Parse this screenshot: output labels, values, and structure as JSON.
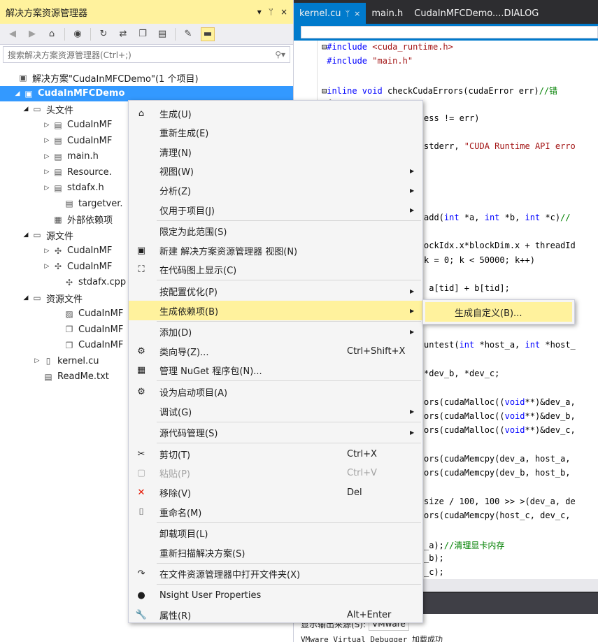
{
  "solution_explorer": {
    "title": "解决方案资源管理器",
    "title_controls": [
      "▾",
      "ᛘ",
      "×"
    ],
    "search_placeholder": "搜索解决方案资源管理器(Ctrl+;)",
    "tree": [
      {
        "label": "解决方案\"CudaInMFCDemo\"(1 个项目)",
        "expander": "",
        "icon": "▣",
        "icon_name": "solution-icon"
      },
      {
        "label": "CudaInMFCDemo",
        "expander": "◢",
        "icon": "▣",
        "icon_name": "project-icon",
        "selected": true
      },
      {
        "label": "头文件",
        "expander": "◢",
        "icon": "▭",
        "icon_name": "folder-icon"
      },
      {
        "label": "CudaInMF",
        "expander": "▷",
        "icon": "▤",
        "icon_name": "header-file-icon"
      },
      {
        "label": "CudaInMF",
        "expander": "▷",
        "icon": "▤",
        "icon_name": "header-file-icon"
      },
      {
        "label": "main.h",
        "expander": "▷",
        "icon": "▤",
        "icon_name": "header-file-icon"
      },
      {
        "label": "Resource.",
        "expander": "▷",
        "icon": "▤",
        "icon_name": "header-file-icon"
      },
      {
        "label": "stdafx.h",
        "expander": "▷",
        "icon": "▤",
        "icon_name": "header-file-icon"
      },
      {
        "label": "targetver.",
        "expander": "",
        "icon": "▤",
        "icon_name": "header-file-icon"
      },
      {
        "label": "外部依赖项",
        "expander": "",
        "icon": "▦",
        "icon_name": "external-deps-icon"
      },
      {
        "label": "源文件",
        "expander": "◢",
        "icon": "▭",
        "icon_name": "folder-icon"
      },
      {
        "label": "CudaInMF",
        "expander": "▷",
        "icon": "✣",
        "icon_name": "cpp-file-icon"
      },
      {
        "label": "CudaInMF",
        "expander": "▷",
        "icon": "✣",
        "icon_name": "cpp-file-icon"
      },
      {
        "label": "stdafx.cpp",
        "expander": "",
        "icon": "✣",
        "icon_name": "cpp-file-icon"
      },
      {
        "label": "资源文件",
        "expander": "◢",
        "icon": "▭",
        "icon_name": "folder-icon"
      },
      {
        "label": "CudaInMF",
        "expander": "",
        "icon": "▨",
        "icon_name": "image-file-icon"
      },
      {
        "label": "CudaInMF",
        "expander": "",
        "icon": "❐",
        "icon_name": "resource-file-icon"
      },
      {
        "label": "CudaInMF",
        "expander": "",
        "icon": "❐",
        "icon_name": "resource-file-icon"
      },
      {
        "label": "kernel.cu",
        "expander": "▷",
        "icon": "▯",
        "icon_name": "cu-file-icon"
      },
      {
        "label": "ReadMe.txt",
        "expander": "",
        "icon": "▤",
        "icon_name": "text-file-icon"
      }
    ]
  },
  "editor": {
    "tabs": [
      {
        "label": "kernel.cu",
        "pin": "ᛘ",
        "close": "×",
        "active": true
      },
      {
        "label": "main.h",
        "active": false
      },
      {
        "label": "CudaInMFCDemo....DIALOG",
        "active": false
      }
    ],
    "code_lines": [
      {
        "parts": [
          {
            "t": "⊟",
            "c": ""
          },
          {
            "t": "#include ",
            "c": "kw"
          },
          {
            "t": "<cuda_runtime.h>",
            "c": "str"
          }
        ]
      },
      {
        "parts": [
          {
            "t": " #include ",
            "c": "kw"
          },
          {
            "t": "\"main.h\"",
            "c": "str"
          }
        ]
      },
      {
        "parts": [
          {
            "t": "",
            "c": ""
          }
        ]
      },
      {
        "parts": [
          {
            "t": "⊟",
            "c": ""
          },
          {
            "t": "inline void ",
            "c": "kw"
          },
          {
            "t": "checkCudaErrors(cudaError err)",
            "c": ""
          },
          {
            "t": "//错",
            "c": "cm"
          }
        ]
      },
      {
        "parts": [
          {
            "t": " {",
            "c": ""
          }
        ]
      },
      {
        "parts": [
          {
            "t": "ess != err)",
            "c": ""
          }
        ]
      },
      {
        "parts": [
          {
            "t": "",
            "c": ""
          }
        ]
      },
      {
        "parts": [
          {
            "t": "stderr, ",
            "c": ""
          },
          {
            "t": "\"CUDA Runtime API erro",
            "c": "str"
          }
        ]
      },
      {
        "parts": [
          {
            "t": "",
            "c": ""
          }
        ]
      },
      {
        "parts": [
          {
            "t": "",
            "c": ""
          }
        ]
      },
      {
        "parts": [
          {
            "t": "",
            "c": ""
          }
        ]
      },
      {
        "parts": [
          {
            "t": "",
            "c": ""
          }
        ]
      },
      {
        "parts": [
          {
            "t": "add(",
            "c": ""
          },
          {
            "t": "int ",
            "c": "kw"
          },
          {
            "t": "*a, ",
            "c": ""
          },
          {
            "t": "int ",
            "c": "kw"
          },
          {
            "t": "*b, ",
            "c": ""
          },
          {
            "t": "int ",
            "c": "kw"
          },
          {
            "t": "*c)",
            "c": ""
          },
          {
            "t": "//",
            "c": "cm"
          }
        ]
      },
      {
        "parts": [
          {
            "t": "",
            "c": ""
          }
        ]
      },
      {
        "parts": [
          {
            "t": "ockIdx.x*blockDim.x + threadId",
            "c": ""
          }
        ]
      },
      {
        "parts": [
          {
            "t": "k = 0; k < 50000; k++)",
            "c": ""
          }
        ]
      },
      {
        "parts": [
          {
            "t": "",
            "c": ""
          }
        ]
      },
      {
        "parts": [
          {
            "t": " a[tid] + b[tid];",
            "c": ""
          }
        ]
      },
      {
        "parts": [
          {
            "t": "",
            "c": ""
          }
        ]
      },
      {
        "parts": [
          {
            "t": "",
            "c": ""
          }
        ]
      },
      {
        "parts": [
          {
            "t": "",
            "c": ""
          }
        ]
      },
      {
        "parts": [
          {
            "t": "untest(",
            "c": ""
          },
          {
            "t": "int ",
            "c": "kw"
          },
          {
            "t": "*host_a, ",
            "c": ""
          },
          {
            "t": "int ",
            "c": "kw"
          },
          {
            "t": "*host_",
            "c": ""
          }
        ]
      },
      {
        "parts": [
          {
            "t": "",
            "c": ""
          }
        ]
      },
      {
        "parts": [
          {
            "t": "*dev_b, *dev_c;",
            "c": ""
          }
        ]
      },
      {
        "parts": [
          {
            "t": "",
            "c": ""
          }
        ]
      },
      {
        "parts": [
          {
            "t": "ors(cudaMalloc((",
            "c": ""
          },
          {
            "t": "void",
            "c": "kw"
          },
          {
            "t": "**)&dev_a,",
            "c": ""
          }
        ]
      },
      {
        "parts": [
          {
            "t": "ors(cudaMalloc((",
            "c": ""
          },
          {
            "t": "void",
            "c": "kw"
          },
          {
            "t": "**)&dev_b,",
            "c": ""
          }
        ]
      },
      {
        "parts": [
          {
            "t": "ors(cudaMalloc((",
            "c": ""
          },
          {
            "t": "void",
            "c": "kw"
          },
          {
            "t": "**)&dev_c,",
            "c": ""
          }
        ]
      },
      {
        "parts": [
          {
            "t": "",
            "c": ""
          }
        ]
      },
      {
        "parts": [
          {
            "t": "ors(cudaMemcpy(dev_a, host_a,",
            "c": ""
          }
        ]
      },
      {
        "parts": [
          {
            "t": "ors(cudaMemcpy(dev_b, host_b,",
            "c": ""
          }
        ]
      },
      {
        "parts": [
          {
            "t": "",
            "c": ""
          }
        ]
      },
      {
        "parts": [
          {
            "t": "size / 100, 100 >> >(dev_a, de",
            "c": ""
          }
        ]
      },
      {
        "parts": [
          {
            "t": "ors(cudaMemcpy(host_c, dev_c,",
            "c": ""
          }
        ]
      },
      {
        "parts": [
          {
            "t": "",
            "c": ""
          }
        ]
      },
      {
        "parts": [
          {
            "t": "_a);",
            "c": ""
          },
          {
            "t": "//清理显卡内存",
            "c": "cm"
          }
        ]
      },
      {
        "parts": [
          {
            "t": "_b);",
            "c": ""
          }
        ]
      },
      {
        "parts": [
          {
            "t": "_c);",
            "c": ""
          }
        ]
      }
    ]
  },
  "output": {
    "source_label": "显示输出来源(S):",
    "source_value": "VMware",
    "line": "VMware Virtual Debugger 加载成功"
  },
  "context_menu": {
    "items": [
      {
        "label": "生成(U)",
        "icon": "⌂",
        "icon_name": "build-icon"
      },
      {
        "label": "重新生成(E)"
      },
      {
        "label": "清理(N)"
      },
      {
        "label": "视图(W)",
        "submenu": true
      },
      {
        "label": "分析(Z)",
        "submenu": true
      },
      {
        "label": "仅用于项目(J)",
        "submenu": true
      },
      {
        "sep": true
      },
      {
        "label": "限定为此范围(S)"
      },
      {
        "label": "新建 解决方案资源管理器 视图(N)",
        "icon": "▣",
        "icon_name": "new-view-icon"
      },
      {
        "label": "在代码图上显示(C)",
        "icon": "⛶",
        "icon_name": "code-map-icon"
      },
      {
        "sep": true
      },
      {
        "label": "按配置优化(P)",
        "submenu": true
      },
      {
        "label": "生成依赖项(B)",
        "submenu": true,
        "highlight": true
      },
      {
        "sep": true
      },
      {
        "label": "添加(D)",
        "submenu": true
      },
      {
        "label": "类向导(Z)...",
        "shortcut": "Ctrl+Shift+X",
        "icon": "⚙",
        "icon_name": "class-wizard-icon"
      },
      {
        "label": "管理 NuGet 程序包(N)...",
        "icon": "▦",
        "icon_name": "nuget-icon"
      },
      {
        "sep": true
      },
      {
        "label": "设为启动项目(A)",
        "icon": "⚙",
        "icon_name": "startup-gear-icon"
      },
      {
        "label": "调试(G)",
        "submenu": true
      },
      {
        "sep": true
      },
      {
        "label": "源代码管理(S)",
        "submenu": true
      },
      {
        "sep": true
      },
      {
        "label": "剪切(T)",
        "shortcut": "Ctrl+X",
        "icon": "✂",
        "icon_name": "cut-icon"
      },
      {
        "label": "粘贴(P)",
        "shortcut": "Ctrl+V",
        "icon": "▢",
        "icon_name": "paste-icon",
        "disabled": true
      },
      {
        "label": "移除(V)",
        "shortcut": "Del",
        "icon": "✕",
        "icon_name": "remove-icon",
        "red": true
      },
      {
        "label": "重命名(M)",
        "icon": "⌷",
        "icon_name": "rename-icon"
      },
      {
        "sep": true
      },
      {
        "label": "卸载项目(L)"
      },
      {
        "label": "重新扫描解决方案(S)"
      },
      {
        "sep": true
      },
      {
        "label": "在文件资源管理器中打开文件夹(X)",
        "icon": "↷",
        "icon_name": "open-folder-icon"
      },
      {
        "sep": true
      },
      {
        "label": "Nsight User Properties",
        "icon": "●",
        "icon_name": "nsight-icon"
      },
      {
        "label": "属性(R)",
        "shortcut": "Alt+Enter",
        "icon": "🔧",
        "icon_name": "wrench-icon"
      }
    ],
    "arrow": "▶"
  },
  "submenu": {
    "item": "生成自定义(B)..."
  }
}
